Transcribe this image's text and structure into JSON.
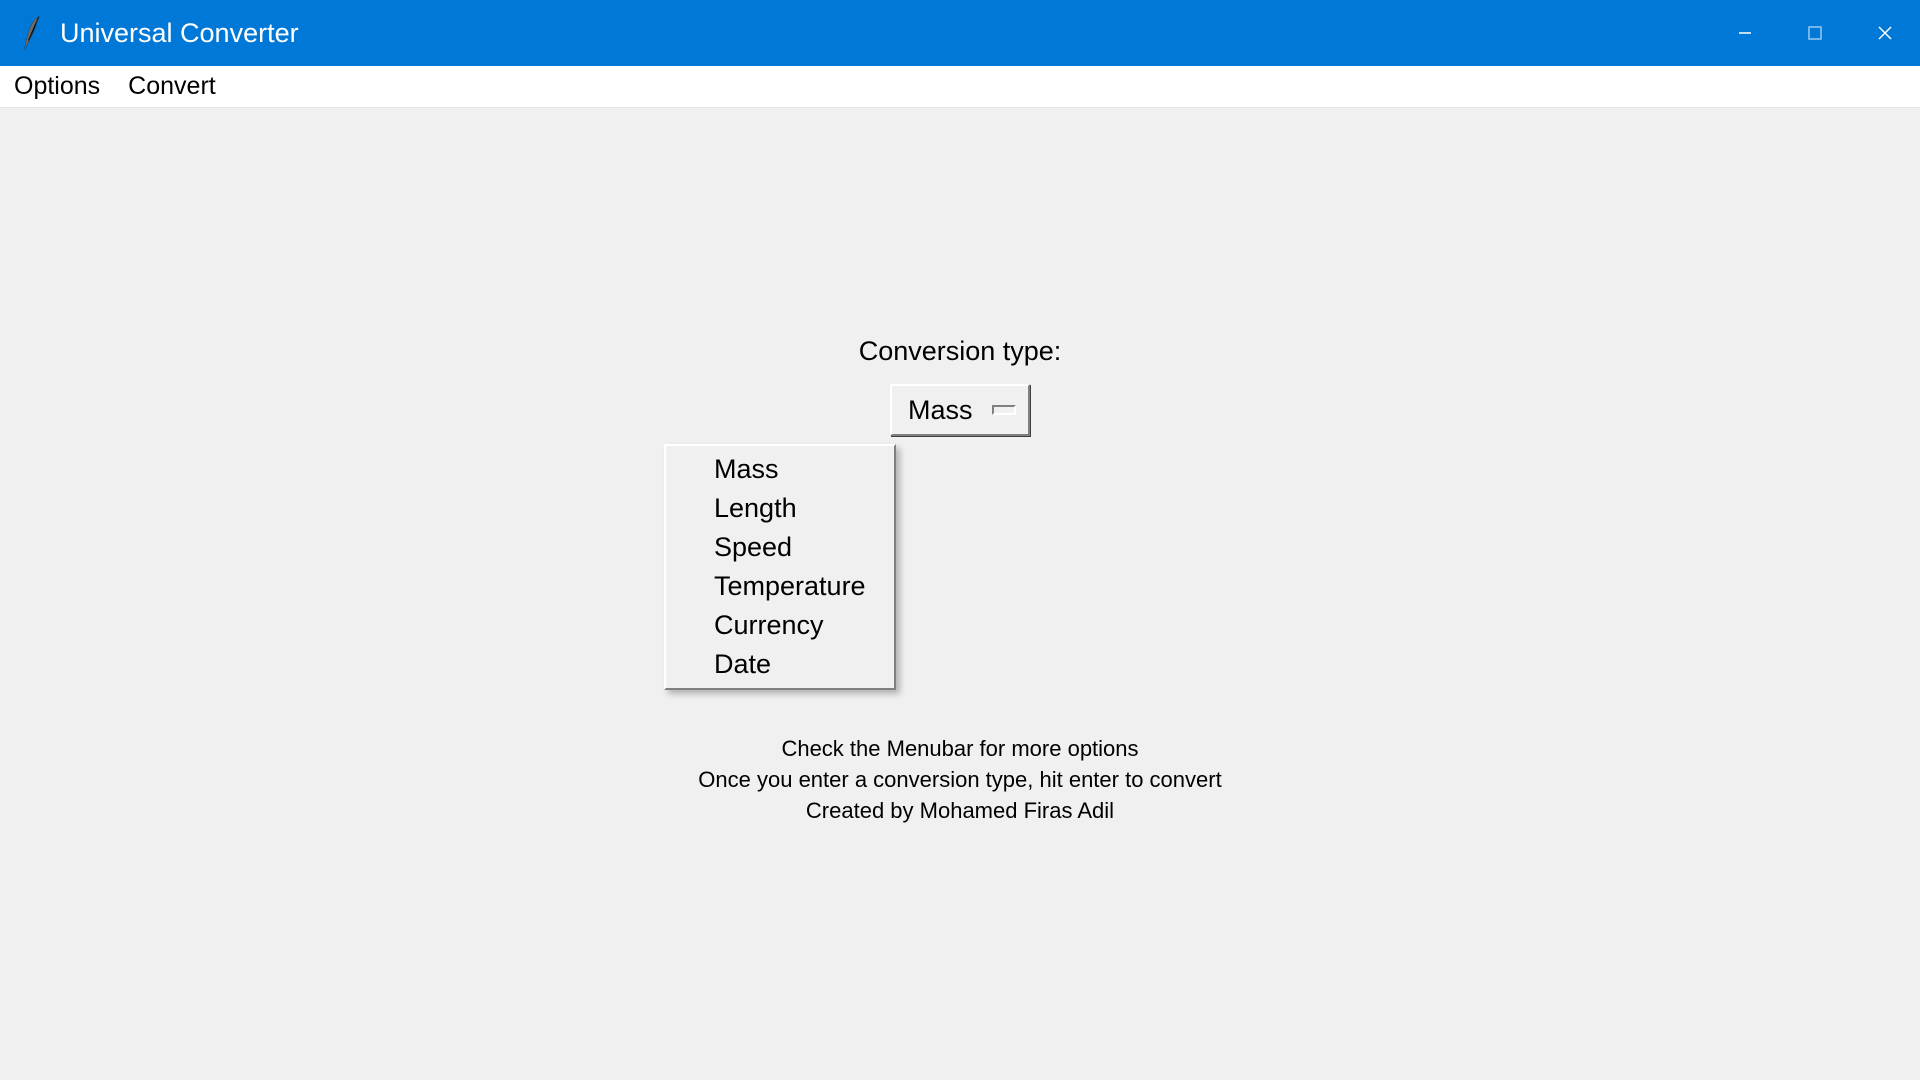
{
  "window": {
    "title": "Universal Converter"
  },
  "menubar": {
    "items": [
      "Options",
      "Convert"
    ]
  },
  "main": {
    "conversion_label": "Conversion type:",
    "selected_value": "Mass",
    "options": [
      "Mass",
      "Length",
      "Speed",
      "Temperature",
      "Currency",
      "Date"
    ]
  },
  "footer": {
    "line1": "Check the Menubar for more options",
    "line2": "Once you enter a conversion type, hit enter to convert",
    "line3": "Created by Mohamed Firas Adil"
  }
}
